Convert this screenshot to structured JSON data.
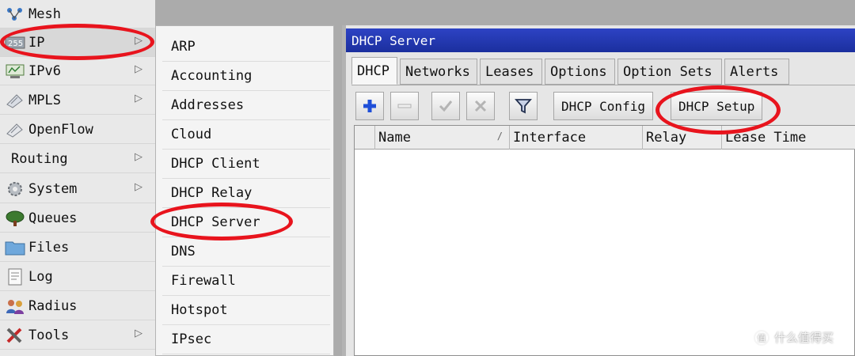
{
  "menu": {
    "items": [
      {
        "label": "Mesh",
        "icon": "mesh-icon",
        "submenu": false
      },
      {
        "label": "IP",
        "icon": "ip-icon",
        "submenu": true
      },
      {
        "label": "IPv6",
        "icon": "ipv6-icon",
        "submenu": true
      },
      {
        "label": "MPLS",
        "icon": "mpls-icon",
        "submenu": true
      },
      {
        "label": "OpenFlow",
        "icon": "openflow-icon",
        "submenu": false
      },
      {
        "label": "Routing",
        "icon": "",
        "submenu": true
      },
      {
        "label": "System",
        "icon": "gear-icon",
        "submenu": true
      },
      {
        "label": "Queues",
        "icon": "queues-icon",
        "submenu": false
      },
      {
        "label": "Files",
        "icon": "folder-icon",
        "submenu": false
      },
      {
        "label": "Log",
        "icon": "log-icon",
        "submenu": false
      },
      {
        "label": "Radius",
        "icon": "radius-icon",
        "submenu": false
      },
      {
        "label": "Tools",
        "icon": "tools-icon",
        "submenu": true
      }
    ]
  },
  "submenu": {
    "items": [
      "ARP",
      "Accounting",
      "Addresses",
      "Cloud",
      "DHCP Client",
      "DHCP Relay",
      "DHCP Server",
      "DNS",
      "Firewall",
      "Hotspot",
      "IPsec"
    ]
  },
  "window": {
    "title": "DHCP Server",
    "tabs": [
      "DHCP",
      "Networks",
      "Leases",
      "Options",
      "Option Sets",
      "Alerts"
    ],
    "active_tab": "DHCP",
    "toolbar": {
      "add_icon": "plus-icon",
      "remove_icon": "minus-icon",
      "enable_icon": "check-icon",
      "disable_icon": "x-icon",
      "filter_icon": "filter-icon",
      "dhcp_config_label": "DHCP Config",
      "dhcp_setup_label": "DHCP Setup"
    },
    "table": {
      "columns": [
        "Name",
        "Interface",
        "Relay",
        "Lease Time"
      ],
      "sort_mark": "/",
      "rows": []
    }
  },
  "watermark": {
    "badge": "值",
    "text": "什么值得买"
  },
  "colors": {
    "annotation": "#e8141d",
    "title_bar": "#2339b8",
    "add_icon": "#1f4fd8"
  }
}
